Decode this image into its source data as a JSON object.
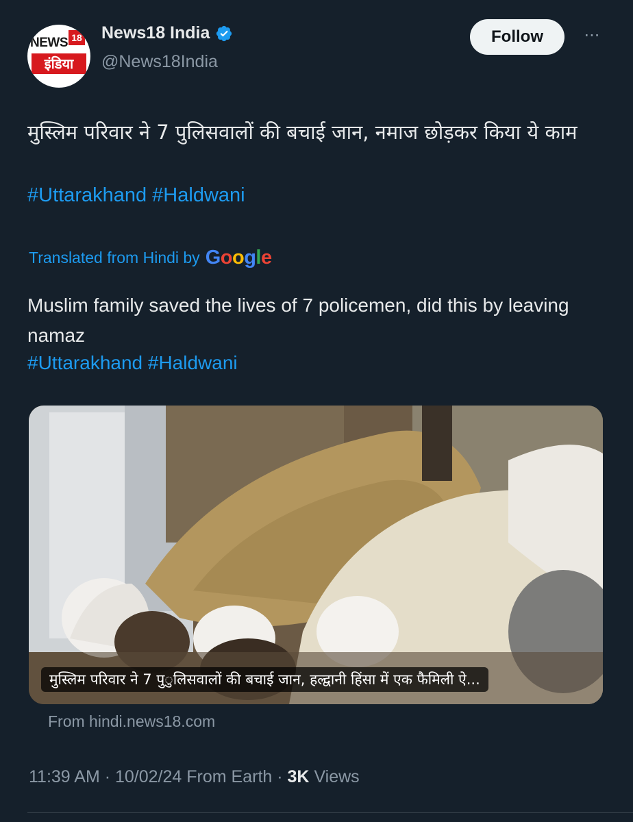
{
  "account": {
    "logo_text_top": "NEWS",
    "logo_text_num": "18",
    "logo_text_bottom": "इंडिया",
    "name": "News18 India",
    "handle": "@News18India",
    "verified_icon": "verified-badge-icon",
    "verified_color": "#1d9bf0"
  },
  "actions": {
    "follow_label": "Follow",
    "more_label": "···"
  },
  "tweet": {
    "original_text": "मुस्लिम परिवार ने 7 पुलिसवालों की बचाई जान, नमाज छोड़कर किया ये काम",
    "original_hashtags": "#Uttarakhand #Haldwani",
    "translated_prefix": "Translated from Hindi by",
    "google_letters": [
      "G",
      "o",
      "o",
      "g",
      "l",
      "e"
    ],
    "translated_text": "Muslim family saved the lives of 7 policemen, did this by leaving namaz",
    "translated_hashtags": "#Uttarakhand #Haldwani"
  },
  "card": {
    "caption": "मुस्लिम परिवार ने 7 पु◌ुलिसवालों की बचाई जान, हल्द्वानी हिंसा में एक फैमिली ऐ...",
    "source": "From hindi.news18.com"
  },
  "meta": {
    "time": "11:39 AM",
    "sep1": " · ",
    "date": "10/02/24",
    "location": " From Earth",
    "sep2": " · ",
    "views_count": "3K",
    "views_label": " Views"
  },
  "colors": {
    "background": "#15202b",
    "link": "#1d9bf0",
    "secondary_text": "#8b98a5"
  }
}
